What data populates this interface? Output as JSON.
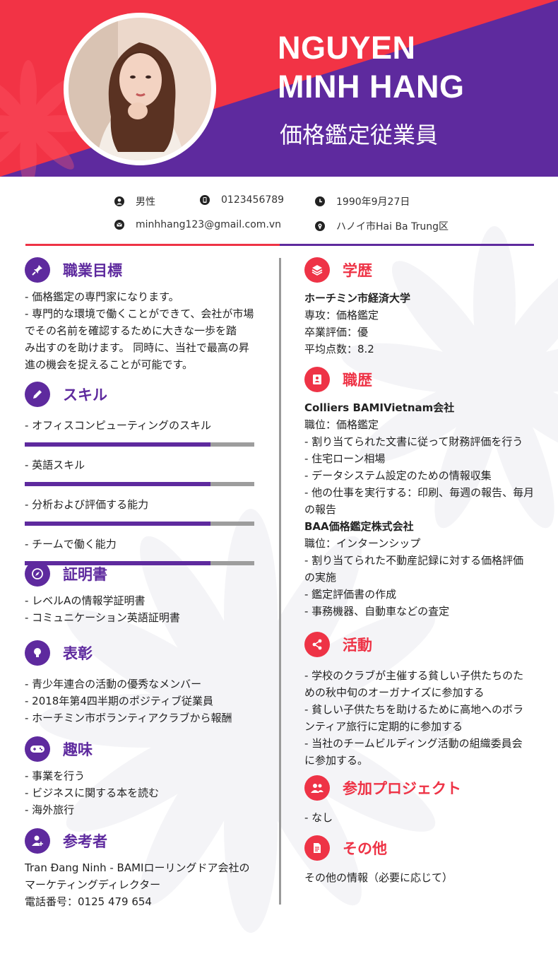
{
  "header": {
    "name_line1": "NGUYEN",
    "name_line2": "MINH HANG",
    "job_title": "価格鑑定従業員"
  },
  "colors": {
    "red": "#ee3346",
    "purple": "#5e2a9e"
  },
  "contact": {
    "gender": {
      "icon": "user-icon",
      "text": "男性"
    },
    "phone": {
      "icon": "phone-icon",
      "text": "0123456789"
    },
    "birthday": {
      "icon": "clock-icon",
      "text": "1990年9月27日"
    },
    "email": {
      "icon": "mail-icon",
      "text": "minhhang123@gmail.com.vn"
    },
    "address": {
      "icon": "location-icon",
      "text": "ハノイ市Hai Ba Trung区"
    }
  },
  "left": {
    "objective": {
      "title": "職業目標",
      "icon": "pin-icon",
      "lines": [
        "- 価格鑑定の専門家になります。",
        "- 専門的な環境で働くことができて、会社が市場",
        "でその名前を確認するために大きな一歩を踏",
        "み出すのを助けます。 同時に、当社で最高の昇",
        "進の機会を捉えることが可能です。"
      ]
    },
    "skills": {
      "title": "スキル",
      "icon": "pencil-icon",
      "items": [
        {
          "label": "- オフィスコンピューティングのスキル",
          "level": 0.81
        },
        {
          "label": "- 英語スキル",
          "level": 0.81
        },
        {
          "label": "- 分析および評価する能力",
          "level": 0.81
        },
        {
          "label": "- チームで働く能力",
          "level": 0.81
        }
      ]
    },
    "certificates": {
      "title": "証明書",
      "icon": "compass-icon",
      "lines": [
        "- レベルAの情報学証明書",
        "- コミュニケーション英語証明書"
      ]
    },
    "awards": {
      "title": "表彰",
      "icon": "lightbulb-icon",
      "lines": [
        "- 青少年連合の活動の優秀なメンバー",
        "-  2018年第4四半期のポジティブ従業員",
        "- ホーチミン市ボランティアクラブから報酬"
      ]
    },
    "hobbies": {
      "title": "趣味",
      "icon": "gamepad-icon",
      "lines": [
        "- 事業を行う",
        "- ビジネスに関する本を読む",
        "- 海外旅行"
      ]
    },
    "references": {
      "title": "参考者",
      "icon": "add-user-icon",
      "lines": [
        "Tran Đang Ninh - BAMIローリングドア会社の",
        "マーケティングディレクター",
        "電話番号：0125 479 654"
      ]
    }
  },
  "right": {
    "education": {
      "title": "学歴",
      "icon": "layers-icon",
      "school": "ホーチミン市経済大学",
      "lines": [
        "専攻：価格鑑定",
        "卒業評価：優",
        "平均点数：8.2"
      ]
    },
    "experience": {
      "title": "職歴",
      "icon": "id-card-icon",
      "jobs": [
        {
          "company": "Colliers BAMIVietnam会社",
          "lines": [
            "職位：価格鑑定",
            " - 割り当てられた文書に従って財務評価を行う",
            " - 住宅ローン相場",
            " - データシステム設定のための情報収集",
            " -  他の仕事を実行する：印刷、毎週の報告、毎月",
            "の報告"
          ]
        },
        {
          "company": "BAA価格鑑定株式会社",
          "lines": [
            "職位：インターンシップ",
            "-  割り当てられた不動産記録に対する価格評価",
            "の実施",
            " - 鑑定評価書の作成",
            " - 事務機器、自動車などの査定"
          ]
        }
      ]
    },
    "activities": {
      "title": "活動",
      "icon": "share-icon",
      "lines": [
        "-  学校のクラブが主催する貧しい子供たちのた",
        "めの秋中旬のオーガナイズに参加する",
        "-  貧しい子供たちを助けるために高地へのボラ",
        "ンティア旅行に定期的に参加する",
        "-  当社のチームビルディング活動の組織委員会",
        "に参加する。"
      ]
    },
    "projects": {
      "title": "参加プロジェクト",
      "icon": "group-icon",
      "lines": [
        "- なし"
      ]
    },
    "other": {
      "title": "その他",
      "icon": "document-icon",
      "lines": [
        "その他の情報（必要に応じて）"
      ]
    }
  }
}
